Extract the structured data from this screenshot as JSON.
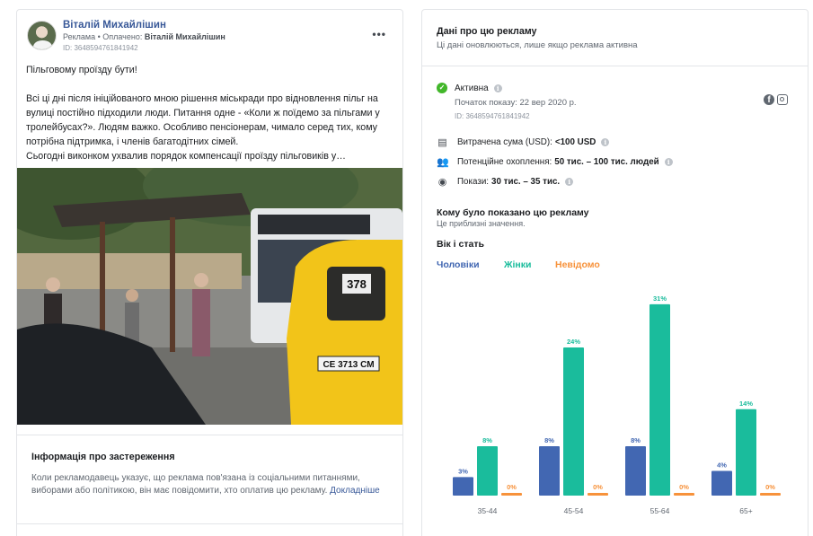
{
  "ad": {
    "page_name": "Віталій Михайлішин",
    "sponsored_prefix": "Реклама • Оплачено: ",
    "payer": "Віталій Михайлішин",
    "id": "ID: 3648594761841942",
    "more_label": "•••",
    "paragraphs": [
      "Пільговому проїзду бути!",
      "Всі ці дні після ініційованого мною рішення міськради про відновлення пільг на вулиці постійно підходили люди. Питання одне - «Коли ж поїдемо за пільгами у тролейбусах?». Людям важко. Особливо пенсіонерам, чимало серед тих, кому потрібна підтримка, і членів багатодітних сімей.\nСьогодні виконком ухвалив порядок компенсації проїзду пільговиків у…"
    ],
    "photo_plate": "СЕ 3713 СМ",
    "photo_bus_number": "378"
  },
  "disclaimer": {
    "title": "Інформація про застереження",
    "text": "Коли рекламодавець указує, що реклама пов'язана із соціальними питаннями, виборами або політикою, він має повідомити, хто оплатив цю рекламу.",
    "link": "Докладніше"
  },
  "info": {
    "title": "Дані про цю рекламу",
    "subtitle": "Ці дані оновлюються, лише якщо реклама активна",
    "status": "Активна",
    "start": "Початок показу: 22 вер 2020 р.",
    "id": "ID: 3648594761841942",
    "spend_label": "Витрачена сума (USD):",
    "spend_value": "<100 USD",
    "reach_label": "Потенційне охоплення:",
    "reach_value": "50 тис. – 100 тис. людей",
    "impr_label": "Покази:",
    "impr_value": "30 тис. – 35 тис."
  },
  "audience": {
    "title": "Кому було показано цю рекламу",
    "subtitle": "Це приблизні значення.",
    "section": "Вік і стать"
  },
  "colors": {
    "men": "#4267b2",
    "women": "#1abc9c",
    "unknown": "#f7923b"
  },
  "chart_data": {
    "type": "bar",
    "categories": [
      "35-44",
      "45-54",
      "55-64",
      "65+"
    ],
    "series": [
      {
        "name": "Чоловіки",
        "values": [
          3,
          8,
          8,
          4
        ]
      },
      {
        "name": "Жінки",
        "values": [
          8,
          24,
          31,
          14
        ]
      },
      {
        "name": "Невідомо",
        "values": [
          0,
          0,
          0,
          0
        ]
      }
    ],
    "value_suffix": "%",
    "ylim": [
      0,
      32
    ],
    "grid": false,
    "legend": "top-left"
  }
}
